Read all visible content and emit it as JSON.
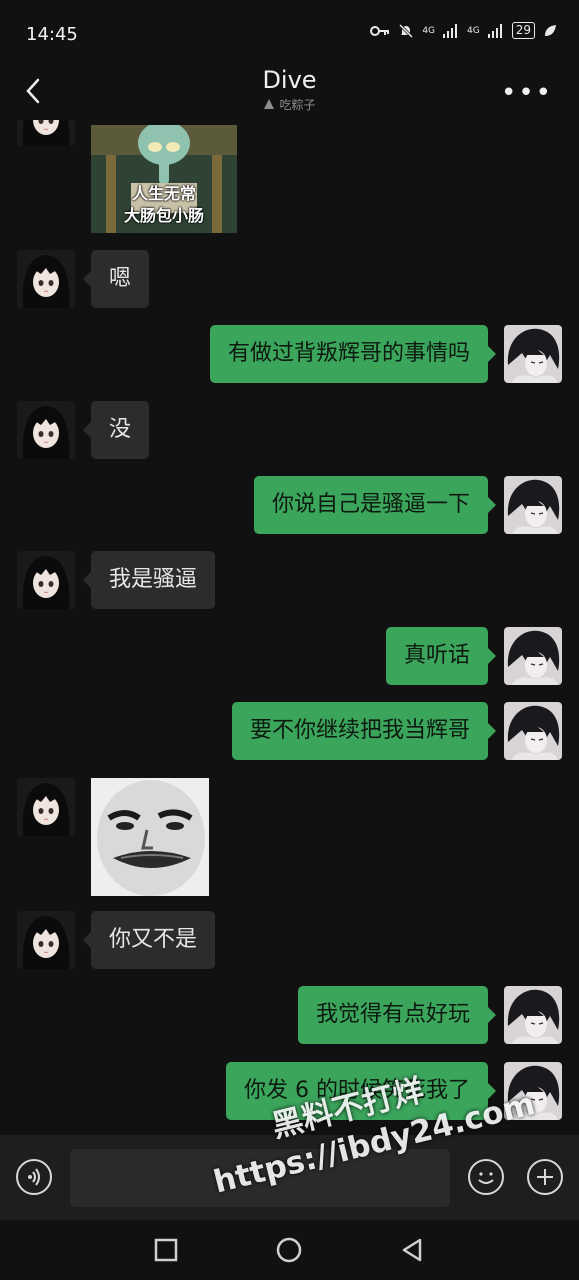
{
  "status_bar": {
    "time": "14:45",
    "network_1": "4G",
    "network_2": "4G",
    "battery": "29"
  },
  "header": {
    "title": "Dive",
    "subtitle": "吃粽子"
  },
  "messages": [
    {
      "side": "in",
      "type": "sticker",
      "caption_line1": "人生无常",
      "caption_line2": "大肠包小肠"
    },
    {
      "side": "in",
      "type": "text",
      "text": "嗯"
    },
    {
      "side": "out",
      "type": "text",
      "text": "有做过背叛辉哥的事情吗"
    },
    {
      "side": "in",
      "type": "text",
      "text": "没"
    },
    {
      "side": "out",
      "type": "text",
      "text": "你说自己是骚逼一下"
    },
    {
      "side": "in",
      "type": "text",
      "text": "我是骚逼"
    },
    {
      "side": "out",
      "type": "text",
      "text": "真听话"
    },
    {
      "side": "out",
      "type": "text",
      "text": "要不你继续把我当辉哥"
    },
    {
      "side": "in",
      "type": "sticker",
      "description_icon": "meme-face-sticker"
    },
    {
      "side": "in",
      "type": "text",
      "text": "你又不是"
    },
    {
      "side": "out",
      "type": "text",
      "text": "我觉得有点好玩"
    },
    {
      "side": "out",
      "type": "text",
      "text": "你发 6 的时候笑死我了"
    }
  ],
  "watermark": {
    "line1": "黑料不打烊",
    "line2": "https://ibdy24.com"
  },
  "colors": {
    "background": "#111111",
    "outgoing_bubble": "#3ba55c",
    "incoming_bubble": "#2c2c2c"
  }
}
